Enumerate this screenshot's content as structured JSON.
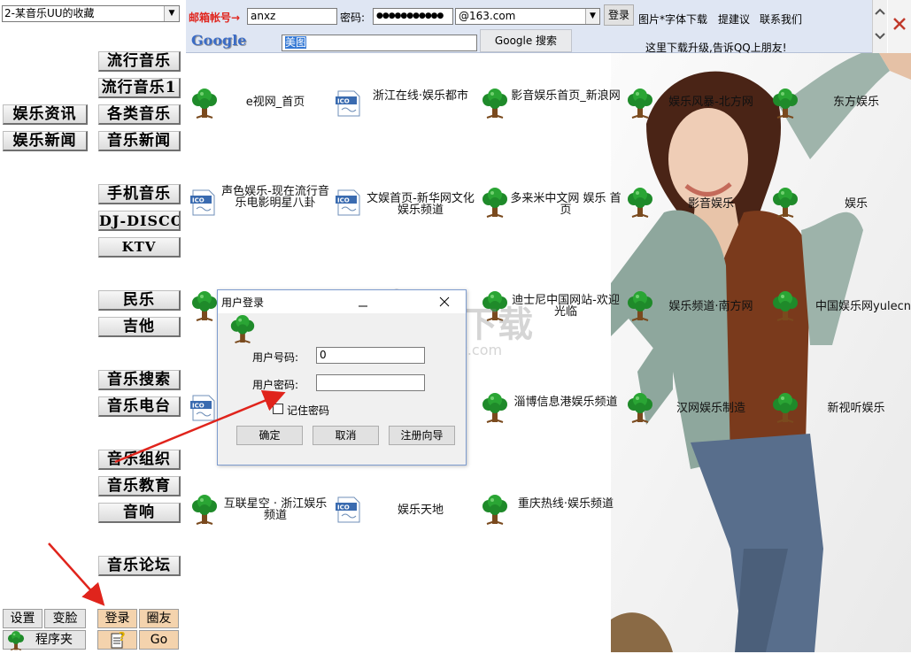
{
  "left_panel": {
    "collection_select": "2-某音乐UU的收藏",
    "category_buttons": [
      "流行音乐",
      "流行音乐1",
      "娱乐资讯",
      "各类音乐",
      "娱乐新闻",
      "音乐新闻",
      "手机音乐",
      "DJ-DISCO",
      "KTV",
      "民乐",
      "吉他",
      "音乐搜索",
      "音乐电台",
      "音乐组织",
      "音乐教育",
      "音响",
      "音乐论坛"
    ],
    "bottom_buttons": [
      "设置",
      "变脸",
      "登录",
      "圈友",
      "程序夹",
      "Go"
    ]
  },
  "toolbar": {
    "mail_label": "邮箱帐号→",
    "account_value": "anxz",
    "password_label": "密码:",
    "password_value": "●●●●●●●●●●●",
    "domain_value": "@163.com",
    "login_button": "登录",
    "links": [
      "图片*字体下载",
      "提建议",
      "联系我们"
    ],
    "google_logo": "Google",
    "search_value": "美图",
    "google_search_button": "Google 搜索",
    "notice": "这里下载升级,告诉QQ上朋友!"
  },
  "links": [
    {
      "icon": "tree",
      "text": "e视网_首页"
    },
    {
      "icon": "ico",
      "text": "浙江在线·娱乐都市"
    },
    {
      "icon": "tree",
      "text": "影音娱乐首页_新浪网"
    },
    {
      "icon": "tree",
      "text": "娱乐风暴-北方网"
    },
    {
      "icon": "tree",
      "text": "东方娱乐"
    },
    {
      "icon": "ico",
      "text": "声色娱乐-现在流行音乐电影明星八卦"
    },
    {
      "icon": "ico",
      "text": "文娱首页-新华网文化娱乐频道"
    },
    {
      "icon": "tree",
      "text": "多来米中文网 娱乐 首页"
    },
    {
      "icon": "tree",
      "text": "影音娱乐"
    },
    {
      "icon": "tree",
      "text": "娱乐"
    },
    {
      "icon": "tree",
      "text": "迪士尼中国网站-欢迎光临"
    },
    {
      "icon": "tree",
      "text": "娱乐频道·南方网"
    },
    {
      "icon": "tree",
      "text": "中国娱乐网yulecn"
    },
    {
      "icon": "tree",
      "text": "淄博信息港娱乐频道"
    },
    {
      "icon": "tree",
      "text": "汉网娱乐制造"
    },
    {
      "icon": "tree",
      "text": "新视听娱乐"
    },
    {
      "icon": "tree",
      "text": "互联星空 · 浙江娱乐频道"
    },
    {
      "icon": "ico",
      "text": "娱乐天地"
    },
    {
      "icon": "tree",
      "text": "重庆热线·娱乐频道"
    }
  ],
  "dialog": {
    "title": "用户登录",
    "user_label": "用户号码:",
    "user_value": "0",
    "password_label": "用户密码:",
    "password_value": "",
    "remember_label": "记住密码",
    "ok_button": "确定",
    "cancel_button": "取消",
    "register_button": "注册向导"
  },
  "watermark": {
    "text": "安下载",
    "subtext": "anxz.com"
  },
  "colors": {
    "accent_red": "#e0241c",
    "toolbar_bg": "#dfe6f3",
    "orange_button": "#f4d3ad"
  }
}
